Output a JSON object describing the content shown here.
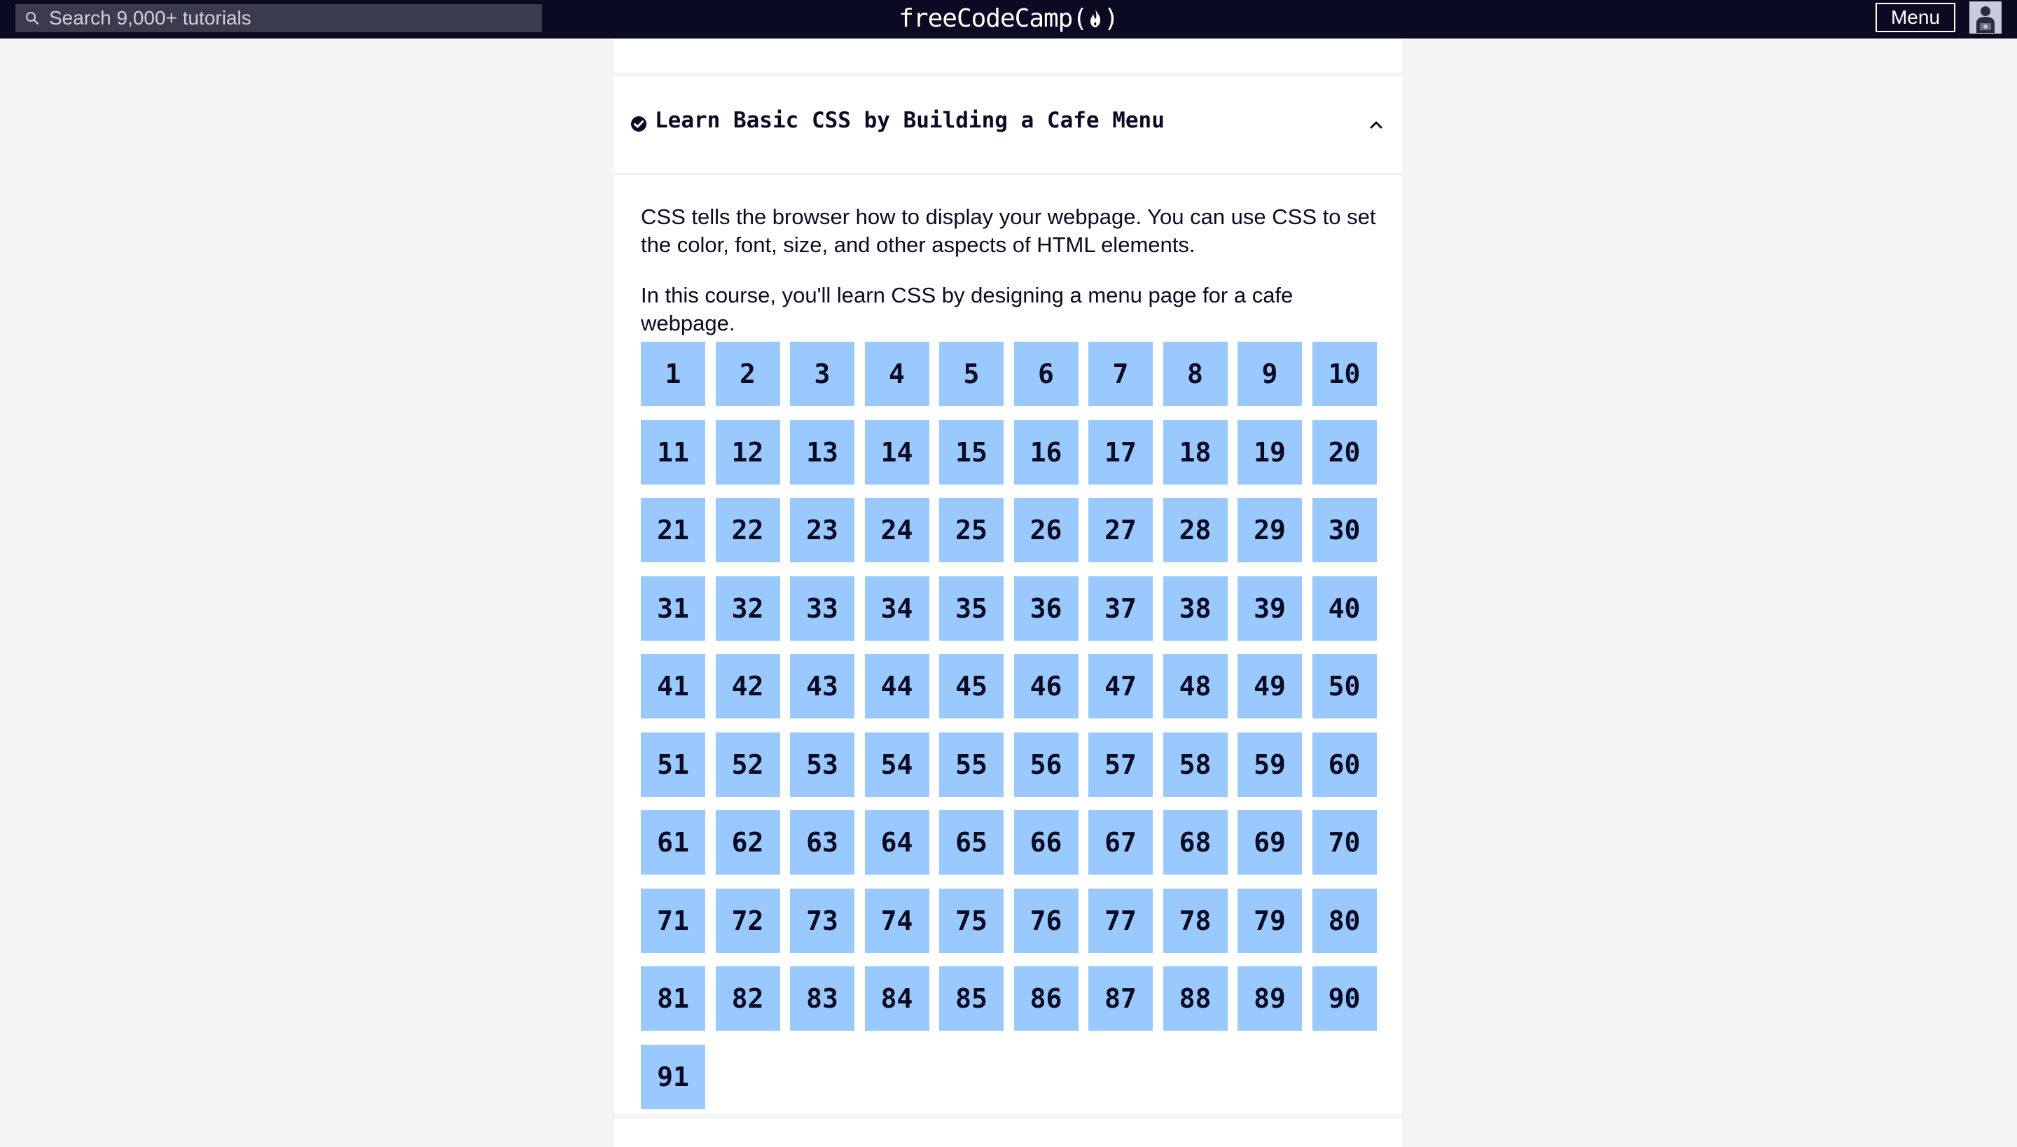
{
  "header": {
    "search_placeholder": "Search 9,000+ tutorials",
    "logo_left": "freeCodeCamp(",
    "logo_right": ")",
    "menu_label": "Menu"
  },
  "block": {
    "title": "Learn Basic CSS by Building a Cafe Menu",
    "completed": true,
    "expanded": true,
    "description_1": "CSS tells the browser how to display your webpage. You can use CSS to set the color, font, size, and other aspects of HTML elements.",
    "description_2": "In this course, you'll learn CSS by designing a menu page for a cafe webpage.",
    "steps": [
      "1",
      "2",
      "3",
      "4",
      "5",
      "6",
      "7",
      "8",
      "9",
      "10",
      "11",
      "12",
      "13",
      "14",
      "15",
      "16",
      "17",
      "18",
      "19",
      "20",
      "21",
      "22",
      "23",
      "24",
      "25",
      "26",
      "27",
      "28",
      "29",
      "30",
      "31",
      "32",
      "33",
      "34",
      "35",
      "36",
      "37",
      "38",
      "39",
      "40",
      "41",
      "42",
      "43",
      "44",
      "45",
      "46",
      "47",
      "48",
      "49",
      "50",
      "51",
      "52",
      "53",
      "54",
      "55",
      "56",
      "57",
      "58",
      "59",
      "60",
      "61",
      "62",
      "63",
      "64",
      "65",
      "66",
      "67",
      "68",
      "69",
      "70",
      "71",
      "72",
      "73",
      "74",
      "75",
      "76",
      "77",
      "78",
      "79",
      "80",
      "81",
      "82",
      "83",
      "84",
      "85",
      "86",
      "87",
      "88",
      "89",
      "90",
      "91"
    ]
  },
  "icons": {
    "search": "search-icon",
    "flame": "flame-icon",
    "check": "check-circle-icon",
    "chevron": "chevron-up-icon",
    "avatar": "avatar-icon"
  },
  "colors": {
    "navbar": "#0a0a23",
    "search_bg": "#3b3b4f",
    "step_tile": "#99c9ff",
    "page_bg": "#f4f5f7",
    "text": "#0a0a23"
  }
}
